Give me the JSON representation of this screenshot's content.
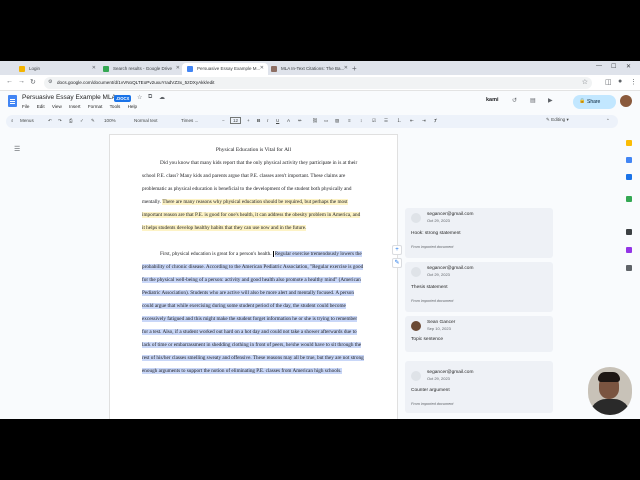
{
  "browser": {
    "tabs": [
      {
        "label": "Login",
        "favicon_color": "#f4b400"
      },
      {
        "label": "Search results - Google Drive",
        "favicon_color": "#34a853"
      },
      {
        "label": "Persuasive Essay Example M...",
        "favicon_color": "#4285f4",
        "active": true
      },
      {
        "label": "MLA In-Text Citations: The Ba...",
        "favicon_color": "#8d6e63"
      }
    ],
    "url": "docs.google.com/document/d/1vVNoQLTEoPv2uxuYradVZ3x_5zDXyAkk/edit"
  },
  "docs": {
    "title": "Persuasive Essay Example MLA",
    "badge": ".DOCX",
    "menu": [
      "File",
      "Edit",
      "View",
      "Insert",
      "Format",
      "Tools",
      "Help"
    ],
    "kami": "kami",
    "share": "Share",
    "toolbar": {
      "menus": "Menus",
      "zoom": "100%",
      "style": "Normal text",
      "font": "Times ...",
      "font_size": "12",
      "mode": "Editing"
    }
  },
  "document": {
    "title": "Physical Education is Vital for All",
    "para1": "Did you know that many kids report that the only physical activity they participate in is at their school P.E. class? Many kids and parents argue that P.E. classes aren't important. These claims are problematic as physical education is beneficial to the development of the student both physically and mentally.",
    "para1_highlight": "There are many reasons why physical education should be required, but perhaps the most important reason are that P.E. is good for one's health, it can address the obesity problem in America, and it helps students develop healthy habits that they can use now and in the future.",
    "para2_plain": "First, physical education is great for a person's health.",
    "para2_selected": "Regular exercise tremendously lowers the probability of chronic disease. According to the American Pediatric Association, \"Regular exercise is good for the physical well-being of a person: activity and good health also promote a healthy mind\" (American Pediatric Association). Students who are active will also be more alert and mentally focused. A person could argue that while exercising during some student period of the day, the student could become excessively fatigued and this might make the student forget information he or she is trying to remember for a test. Also, if a student worked out hard on a hot day and could not take a shower afterwards due to lack of time or embarrassment in shedding clothing in front of peers, he/she would have to sit through the rest of his/her classes smelling sweaty and offensive. These reasons may all be true, but they are not strong enough arguments to support the notion of eliminating P.E. classes from American high schools."
  },
  "comments": [
    {
      "author": "segancer@gmail.com",
      "date": "Oct 29, 2023",
      "text": "Hook: strong statement",
      "from": "From imported document",
      "photo": false
    },
    {
      "author": "segancer@gmail.com",
      "date": "Oct 29, 2023",
      "text": "Thesis statement",
      "from": "From imported document",
      "photo": false
    },
    {
      "author": "Sean Gancer",
      "date": "Sep 10, 2023",
      "text": "Topic sentence",
      "from": "",
      "photo": true
    },
    {
      "author": "segancer@gmail.com",
      "date": "Oct 29, 2023",
      "text": "Counter argument",
      "from": "From imported document",
      "photo": false
    }
  ],
  "icons": {
    "outline": "list-outline-icon",
    "add_comment": "add-comment-icon",
    "suggest": "suggest-edit-icon"
  }
}
